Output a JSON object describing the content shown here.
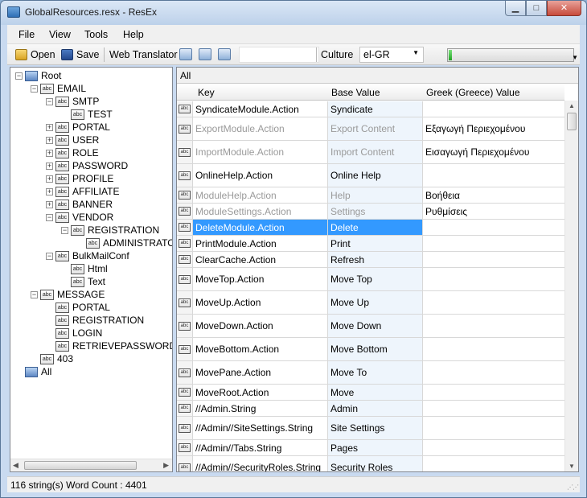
{
  "window": {
    "title": "GlobalResources.resx - ResEx",
    "minimize": "▁",
    "maximize": "□",
    "close": "✕"
  },
  "menu": [
    "File",
    "View",
    "Tools",
    "Help"
  ],
  "toolbar": {
    "open_label": "Open",
    "save_label": "Save",
    "web_translator_label": "Web Translator",
    "icons": [
      "translate-icon",
      "filter-icon",
      "find-icon"
    ],
    "culture_label": "Culture",
    "culture_value": "el-GR",
    "progress_fraction": 0.02
  },
  "tree": {
    "nodes": [
      {
        "label": "Root",
        "depth": 0,
        "expander": "−",
        "icon": "root"
      },
      {
        "label": "EMAIL",
        "depth": 1,
        "expander": "−",
        "icon": "abc"
      },
      {
        "label": "SMTP",
        "depth": 2,
        "expander": "−",
        "icon": "abc"
      },
      {
        "label": "TEST",
        "depth": 3,
        "expander": "",
        "icon": "abc"
      },
      {
        "label": "PORTAL",
        "depth": 2,
        "expander": "+",
        "icon": "abc"
      },
      {
        "label": "USER",
        "depth": 2,
        "expander": "+",
        "icon": "abc"
      },
      {
        "label": "ROLE",
        "depth": 2,
        "expander": "+",
        "icon": "abc"
      },
      {
        "label": "PASSWORD",
        "depth": 2,
        "expander": "+",
        "icon": "abc"
      },
      {
        "label": "PROFILE",
        "depth": 2,
        "expander": "+",
        "icon": "abc"
      },
      {
        "label": "AFFILIATE",
        "depth": 2,
        "expander": "+",
        "icon": "abc"
      },
      {
        "label": "BANNER",
        "depth": 2,
        "expander": "+",
        "icon": "abc"
      },
      {
        "label": "VENDOR",
        "depth": 2,
        "expander": "−",
        "icon": "abc"
      },
      {
        "label": "REGISTRATION",
        "depth": 3,
        "expander": "−",
        "icon": "abc"
      },
      {
        "label": "ADMINISTRATO",
        "depth": 4,
        "expander": "",
        "icon": "abc"
      },
      {
        "label": "BulkMailConf",
        "depth": 2,
        "expander": "−",
        "icon": "abc"
      },
      {
        "label": "Html",
        "depth": 3,
        "expander": "",
        "icon": "abc"
      },
      {
        "label": "Text",
        "depth": 3,
        "expander": "",
        "icon": "abc"
      },
      {
        "label": "MESSAGE",
        "depth": 1,
        "expander": "−",
        "icon": "abc"
      },
      {
        "label": "PORTAL",
        "depth": 2,
        "expander": "",
        "icon": "abc"
      },
      {
        "label": "REGISTRATION",
        "depth": 2,
        "expander": "",
        "icon": "abc"
      },
      {
        "label": "LOGIN",
        "depth": 2,
        "expander": "",
        "icon": "abc"
      },
      {
        "label": "RETRIEVEPASSWORD",
        "depth": 2,
        "expander": "",
        "icon": "abc"
      },
      {
        "label": "403",
        "depth": 1,
        "expander": "",
        "icon": "abc"
      },
      {
        "label": "All",
        "depth": 0,
        "expander": "",
        "icon": "root"
      }
    ]
  },
  "grid": {
    "caption": "All",
    "columns": [
      "Key",
      "Base Value",
      "Greek (Greece) Value"
    ],
    "rows": [
      {
        "key": "SyndicateModule.Action",
        "base": "Syndicate",
        "value": "",
        "state": "normal",
        "height": 20
      },
      {
        "key": "ExportModule.Action",
        "base": "Export Content",
        "value": "Εξαγωγή Περιεχομένου",
        "state": "disabled",
        "height": 29
      },
      {
        "key": "ImportModule.Action",
        "base": "Import Content",
        "value": "Εισαγωγή Περιεχομένου",
        "state": "disabled",
        "height": 29
      },
      {
        "key": "OnlineHelp.Action",
        "base": "Online Help",
        "value": "",
        "state": "normal",
        "height": 29
      },
      {
        "key": "ModuleHelp.Action",
        "base": "Help",
        "value": "Βοήθεια",
        "state": "disabled",
        "height": 20
      },
      {
        "key": "ModuleSettings.Action",
        "base": "Settings",
        "value": "Ρυθμίσεις",
        "state": "disabled",
        "height": 20
      },
      {
        "key": "DeleteModule.Action",
        "base": "Delete",
        "value": "",
        "state": "selected",
        "height": 20
      },
      {
        "key": "PrintModule.Action",
        "base": "Print",
        "value": "",
        "state": "normal",
        "height": 20
      },
      {
        "key": "ClearCache.Action",
        "base": "Refresh",
        "value": "",
        "state": "normal",
        "height": 20
      },
      {
        "key": "MoveTop.Action",
        "base": "Move Top",
        "value": "",
        "state": "normal",
        "height": 29
      },
      {
        "key": "MoveUp.Action",
        "base": "Move Up",
        "value": "",
        "state": "normal",
        "height": 29
      },
      {
        "key": "MoveDown.Action",
        "base": "Move Down",
        "value": "",
        "state": "normal",
        "height": 29
      },
      {
        "key": "MoveBottom.Action",
        "base": "Move Bottom",
        "value": "",
        "state": "normal",
        "height": 29
      },
      {
        "key": "MovePane.Action",
        "base": "Move To",
        "value": "",
        "state": "normal",
        "height": 29
      },
      {
        "key": "MoveRoot.Action",
        "base": "Move",
        "value": "",
        "state": "normal",
        "height": 20
      },
      {
        "key": "//Admin.String",
        "base": "Admin",
        "value": "",
        "state": "normal",
        "height": 20
      },
      {
        "key": "//Admin//SiteSettings.String",
        "base": "Site Settings",
        "value": "",
        "state": "normal",
        "height": 29
      },
      {
        "key": "//Admin//Tabs.String",
        "base": "Pages",
        "value": "",
        "state": "normal",
        "height": 20
      },
      {
        "key": "//Admin//SecurityRoles.String",
        "base": "Security Roles",
        "value": "",
        "state": "normal",
        "height": 29
      }
    ]
  },
  "status": {
    "text": "116 string(s)  Word Count : 4401"
  }
}
